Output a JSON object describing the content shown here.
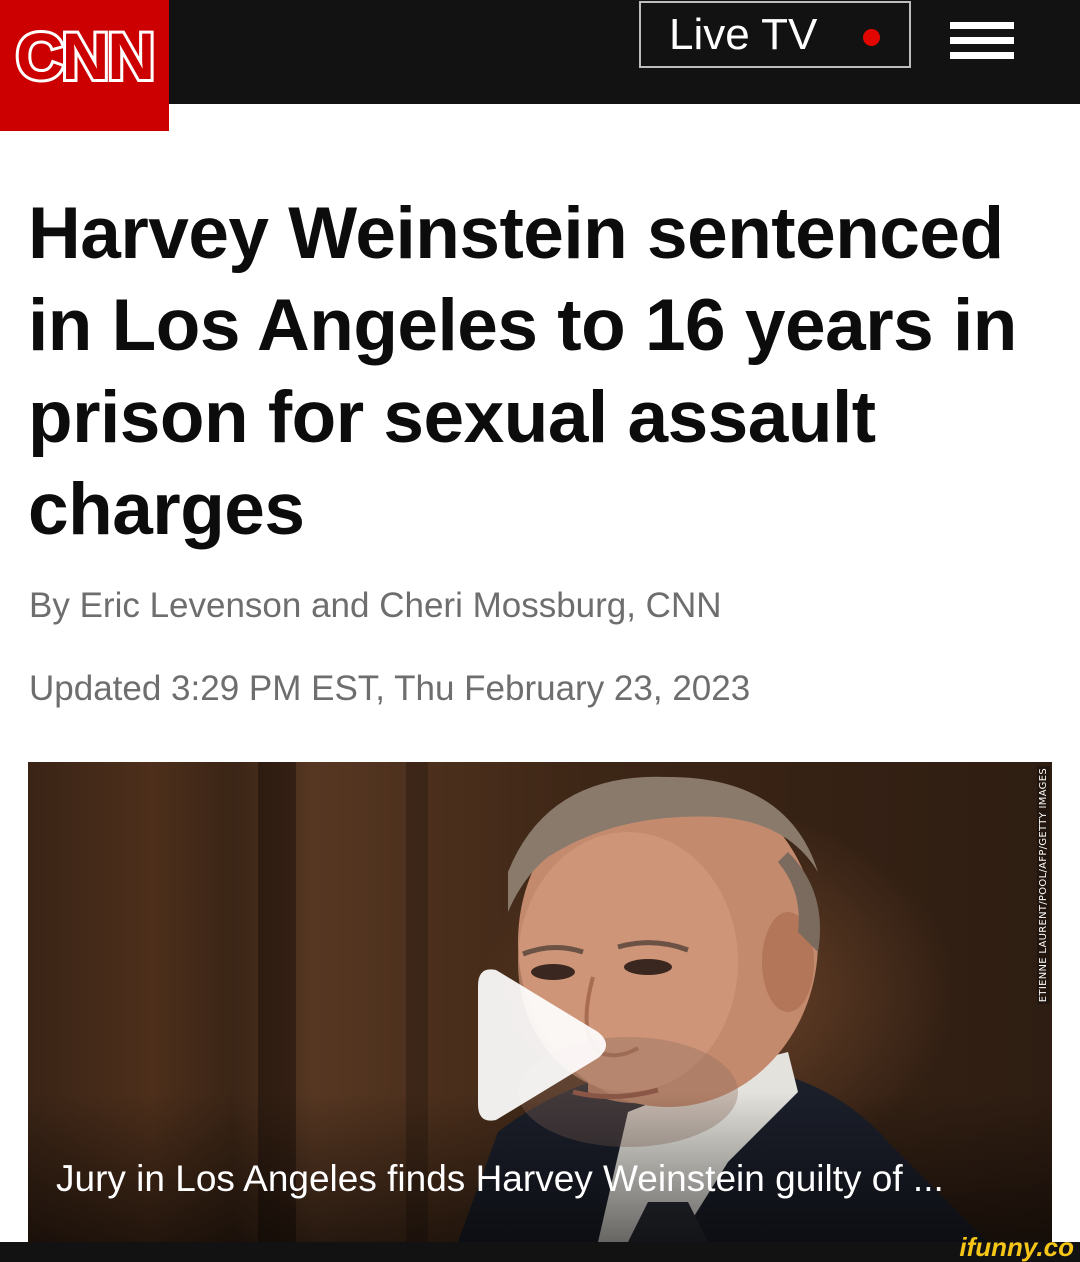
{
  "header": {
    "logo_text": "CNN",
    "live_tv_label": "Live TV",
    "live_indicator_color": "#e10600",
    "brand_color": "#cc0000",
    "menu_icon": "hamburger-menu-icon"
  },
  "article": {
    "headline": "Harvey Weinstein sentenced in Los Angeles to 16 years in prison for sexual assault charges",
    "byline": "By Eric Levenson and Cheri Mossburg, CNN",
    "timestamp": "Updated 3:29 PM EST, Thu February 23, 2023"
  },
  "video": {
    "caption": "Jury in Los Angeles finds Harvey Weinstein guilty of ...",
    "photo_credit": "ETIENNE LAURENT/POOL/AFP/GETTY IMAGES",
    "play_icon": "play-icon"
  },
  "watermark": {
    "text": "ifunny.co"
  }
}
